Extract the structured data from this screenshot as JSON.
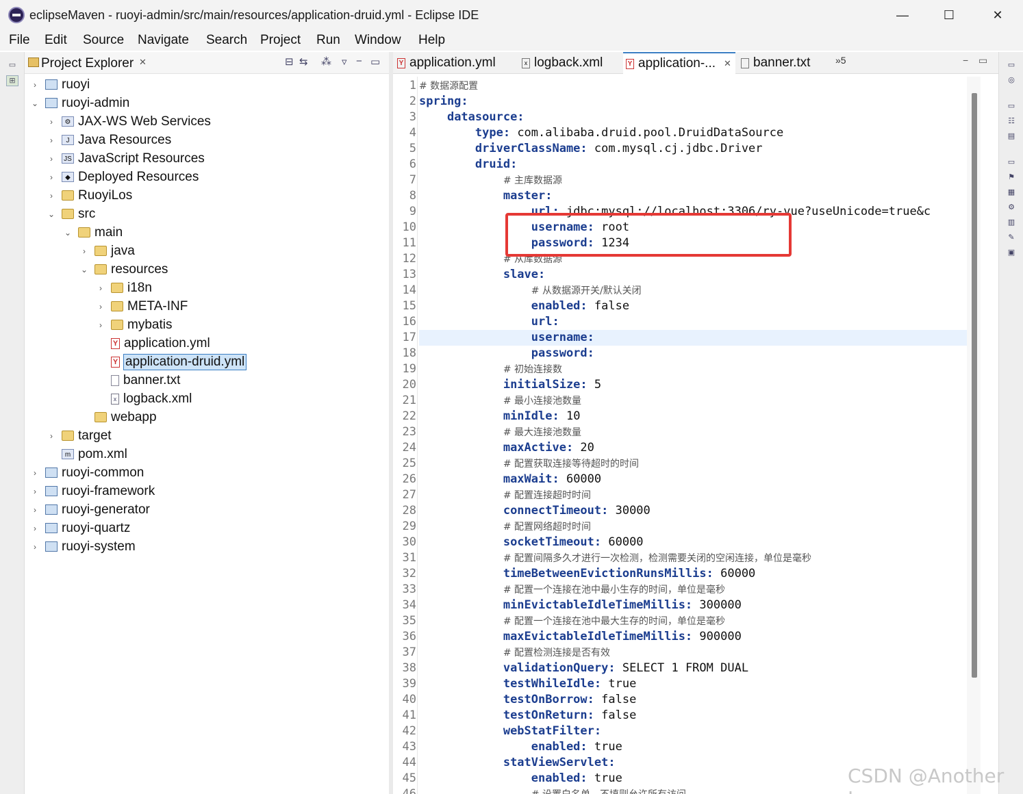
{
  "window": {
    "title": "eclipseMaven - ruoyi-admin/src/main/resources/application-druid.yml - Eclipse IDE",
    "minimize": "—",
    "maximize": "☐",
    "close": "✕"
  },
  "menu": [
    "File",
    "Edit",
    "Source",
    "Navigate",
    "Search",
    "Project",
    "Run",
    "Window",
    "Help"
  ],
  "explorer": {
    "title": "Project Explorer",
    "close": "✕",
    "items": [
      {
        "label": "ruoyi",
        "icon": "project-icon",
        "twisty": "›",
        "depth": 0
      },
      {
        "label": "ruoyi-admin",
        "icon": "project-icon",
        "twisty": "⌄",
        "depth": 0
      },
      {
        "label": "JAX-WS Web Services",
        "icon": "webservice-icon",
        "twisty": "›",
        "depth": 1
      },
      {
        "label": "Java Resources",
        "icon": "java-resources-icon",
        "twisty": "›",
        "depth": 1
      },
      {
        "label": "JavaScript Resources",
        "icon": "javascript-icon",
        "twisty": "›",
        "depth": 1
      },
      {
        "label": "Deployed Resources",
        "icon": "deployed-icon",
        "twisty": "›",
        "depth": 1
      },
      {
        "label": "RuoyiLos",
        "icon": "folder-icon",
        "twisty": "›",
        "depth": 1
      },
      {
        "label": "src",
        "icon": "folder-icon",
        "twisty": "⌄",
        "depth": 1
      },
      {
        "label": "main",
        "icon": "folder-icon",
        "twisty": "⌄",
        "depth": 2
      },
      {
        "label": "java",
        "icon": "folder-icon",
        "twisty": "›",
        "depth": 3
      },
      {
        "label": "resources",
        "icon": "folder-icon",
        "twisty": "⌄",
        "depth": 3
      },
      {
        "label": "i18n",
        "icon": "folder-icon",
        "twisty": "›",
        "depth": 4
      },
      {
        "label": "META-INF",
        "icon": "folder-icon",
        "twisty": "›",
        "depth": 4
      },
      {
        "label": "mybatis",
        "icon": "folder-icon",
        "twisty": "›",
        "depth": 4
      },
      {
        "label": "application.yml",
        "icon": "yml-file-icon",
        "twisty": "",
        "depth": 4
      },
      {
        "label": "application-druid.yml",
        "icon": "yml-file-icon",
        "twisty": "",
        "depth": 4,
        "selected": true
      },
      {
        "label": "banner.txt",
        "icon": "text-file-icon",
        "twisty": "",
        "depth": 4
      },
      {
        "label": "logback.xml",
        "icon": "xml-file-icon",
        "twisty": "",
        "depth": 4
      },
      {
        "label": "webapp",
        "icon": "folder-icon",
        "twisty": "",
        "depth": 3
      },
      {
        "label": "target",
        "icon": "folder-icon",
        "twisty": "›",
        "depth": 1
      },
      {
        "label": "pom.xml",
        "icon": "maven-pom-icon",
        "twisty": "",
        "depth": 1
      },
      {
        "label": "ruoyi-common",
        "icon": "project-icon",
        "twisty": "›",
        "depth": 0
      },
      {
        "label": "ruoyi-framework",
        "icon": "project-icon",
        "twisty": "›",
        "depth": 0
      },
      {
        "label": "ruoyi-generator",
        "icon": "project-icon",
        "twisty": "›",
        "depth": 0
      },
      {
        "label": "ruoyi-quartz",
        "icon": "project-icon",
        "twisty": "›",
        "depth": 0
      },
      {
        "label": "ruoyi-system",
        "icon": "project-icon",
        "twisty": "›",
        "depth": 0
      }
    ]
  },
  "editor": {
    "tabs": [
      {
        "label": "application.yml",
        "icon": "yml-file-icon",
        "active": false
      },
      {
        "label": "logback.xml",
        "icon": "xml-file-icon",
        "active": false
      },
      {
        "label": "application-...",
        "icon": "yml-file-icon",
        "active": true,
        "close": "✕"
      },
      {
        "label": "banner.txt",
        "icon": "text-file-icon",
        "active": false
      }
    ],
    "overflow": "»5",
    "current_line": 17,
    "lines": [
      {
        "n": "1",
        "indent": "",
        "comment": "# 数据源配置"
      },
      {
        "n": "2",
        "indent": "",
        "key": "spring:"
      },
      {
        "n": "3",
        "indent": "    ",
        "key": "datasource:"
      },
      {
        "n": "4",
        "indent": "        ",
        "key": "type:",
        "value": " com.alibaba.druid.pool.DruidDataSource"
      },
      {
        "n": "5",
        "indent": "        ",
        "key": "driverClassName:",
        "value": " com.mysql.cj.jdbc.Driver"
      },
      {
        "n": "6",
        "indent": "        ",
        "key": "druid:"
      },
      {
        "n": "7",
        "indent": "            ",
        "comment": "# 主库数据源"
      },
      {
        "n": "8",
        "indent": "            ",
        "key": "master:"
      },
      {
        "n": "9",
        "indent": "                ",
        "key": "url:",
        "value": " jdbc:mysql://localhost:3306/ry-vue?useUnicode=true&c"
      },
      {
        "n": "10",
        "indent": "                ",
        "key": "username:",
        "value": " root"
      },
      {
        "n": "11",
        "indent": "                ",
        "key": "password:",
        "value": " 1234"
      },
      {
        "n": "12",
        "indent": "            ",
        "comment": "# 从库数据源"
      },
      {
        "n": "13",
        "indent": "            ",
        "key": "slave:"
      },
      {
        "n": "14",
        "indent": "                ",
        "comment": "# 从数据源开关/默认关闭"
      },
      {
        "n": "15",
        "indent": "                ",
        "key": "enabled:",
        "value": " false"
      },
      {
        "n": "16",
        "indent": "                ",
        "key": "url:"
      },
      {
        "n": "17",
        "indent": "                ",
        "key": "username:"
      },
      {
        "n": "18",
        "indent": "                ",
        "key": "password:"
      },
      {
        "n": "19",
        "indent": "            ",
        "comment": "# 初始连接数"
      },
      {
        "n": "20",
        "indent": "            ",
        "key": "initialSize:",
        "value": " 5"
      },
      {
        "n": "21",
        "indent": "            ",
        "comment": "# 最小连接池数量"
      },
      {
        "n": "22",
        "indent": "            ",
        "key": "minIdle:",
        "value": " 10"
      },
      {
        "n": "23",
        "indent": "            ",
        "comment": "# 最大连接池数量"
      },
      {
        "n": "24",
        "indent": "            ",
        "key": "maxActive:",
        "value": " 20"
      },
      {
        "n": "25",
        "indent": "            ",
        "comment": "# 配置获取连接等待超时的时间"
      },
      {
        "n": "26",
        "indent": "            ",
        "key": "maxWait:",
        "value": " 60000"
      },
      {
        "n": "27",
        "indent": "            ",
        "comment": "# 配置连接超时时间"
      },
      {
        "n": "28",
        "indent": "            ",
        "key": "connectTimeout:",
        "value": " 30000"
      },
      {
        "n": "29",
        "indent": "            ",
        "comment": "# 配置网络超时时间"
      },
      {
        "n": "30",
        "indent": "            ",
        "key": "socketTimeout:",
        "value": " 60000"
      },
      {
        "n": "31",
        "indent": "            ",
        "comment": "# 配置间隔多久才进行一次检测，检测需要关闭的空闲连接，单位是毫秒"
      },
      {
        "n": "32",
        "indent": "            ",
        "key": "timeBetweenEvictionRunsMillis:",
        "value": " 60000"
      },
      {
        "n": "33",
        "indent": "            ",
        "comment": "# 配置一个连接在池中最小生存的时间，单位是毫秒"
      },
      {
        "n": "34",
        "indent": "            ",
        "key": "minEvictableIdleTimeMillis:",
        "value": " 300000"
      },
      {
        "n": "35",
        "indent": "            ",
        "comment": "# 配置一个连接在池中最大生存的时间，单位是毫秒"
      },
      {
        "n": "36",
        "indent": "            ",
        "key": "maxEvictableIdleTimeMillis:",
        "value": " 900000"
      },
      {
        "n": "37",
        "indent": "            ",
        "comment": "# 配置检测连接是否有效"
      },
      {
        "n": "38",
        "indent": "            ",
        "key": "validationQuery:",
        "value": " SELECT 1 FROM DUAL"
      },
      {
        "n": "39",
        "indent": "            ",
        "key": "testWhileIdle:",
        "value": " true"
      },
      {
        "n": "40",
        "indent": "            ",
        "key": "testOnBorrow:",
        "value": " false"
      },
      {
        "n": "41",
        "indent": "            ",
        "key": "testOnReturn:",
        "value": " false"
      },
      {
        "n": "42",
        "indent": "            ",
        "key": "webStatFilter:"
      },
      {
        "n": "43",
        "indent": "                ",
        "key": "enabled:",
        "value": " true"
      },
      {
        "n": "44",
        "indent": "            ",
        "key": "statViewServlet:"
      },
      {
        "n": "45",
        "indent": "                ",
        "key": "enabled:",
        "value": " true"
      },
      {
        "n": "46",
        "indent": "                ",
        "comment": "# 设置白名单，不填则允许所有访问"
      }
    ]
  },
  "watermark": "CSDN @Another Iso",
  "colors": {
    "accent": "#3c7fc4",
    "highlight_box": "#e53935",
    "yaml_key": "#1b3d8f"
  }
}
